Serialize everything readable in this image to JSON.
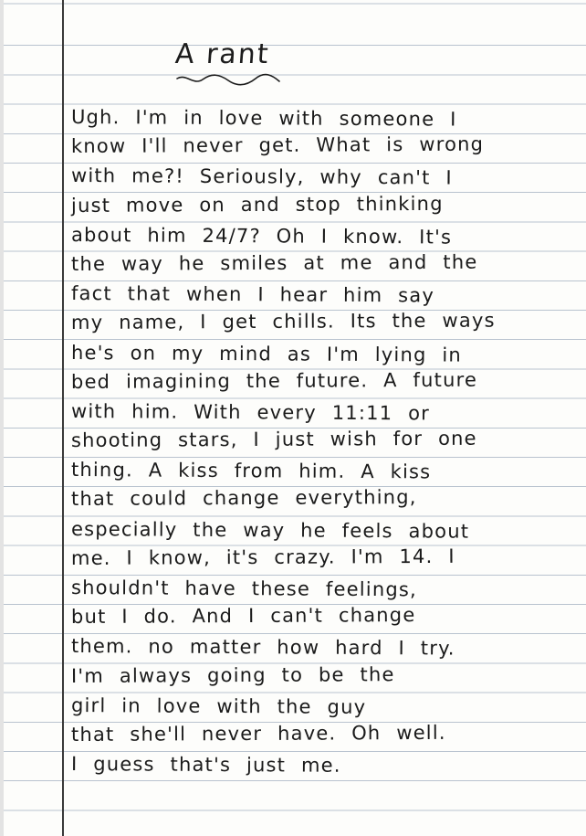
{
  "title": "A rant",
  "lines": [
    "Ugh. I'm in love with someone I",
    "know I'll never get. What is wrong",
    "with me?! Seriously, why can't I",
    "just move on and stop thinking",
    "about him 24/7? Oh I know. It's",
    "the way he smiles at me and the",
    "fact that when I hear him say",
    "my name, I get chills. Its the ways",
    "he's on my mind as I'm lying in",
    "bed imagining the future. A future",
    "with him. With every 11:11 or",
    "shooting stars, I just wish for one",
    "thing. A kiss from him. A kiss",
    "that could change everything,",
    "especially the way he feels about",
    "me. I know, it's crazy. I'm 14. I",
    "shouldn't have these feelings,",
    "but I do. And I can't change",
    "them. no matter how hard I try.",
    "I'm always going to be the",
    "girl in love with the guy",
    "that she'll never have. Oh well.",
    "I guess that's just me."
  ]
}
